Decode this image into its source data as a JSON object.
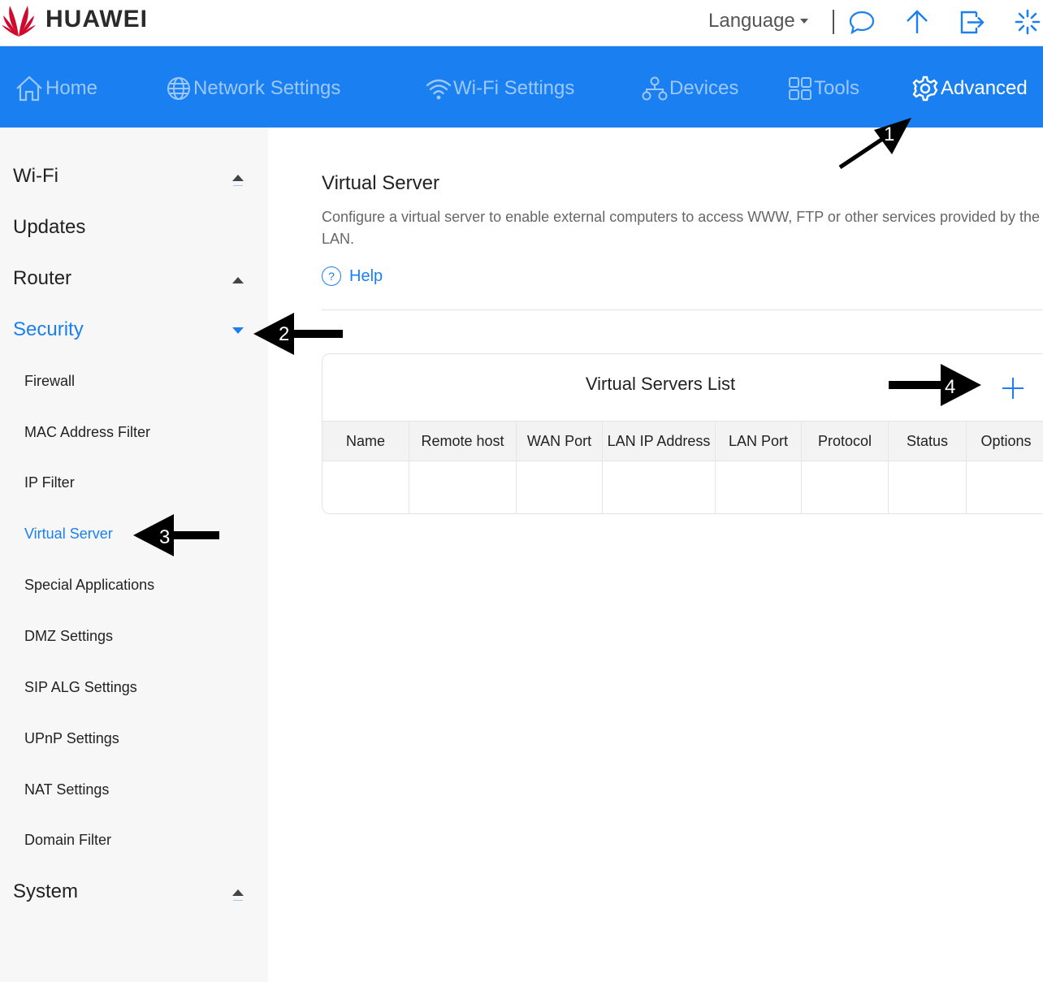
{
  "brand": {
    "name": "HUAWEI",
    "color": "#cf0a2c"
  },
  "header": {
    "language_label": "Language",
    "icons": [
      "chat-icon",
      "upload-icon",
      "logout-icon",
      "loading-icon"
    ]
  },
  "nav": {
    "items": [
      {
        "label": "Home",
        "icon": "home-icon"
      },
      {
        "label": "Network Settings",
        "icon": "globe-icon"
      },
      {
        "label": "Wi-Fi Settings",
        "icon": "wifi-icon"
      },
      {
        "label": "Devices",
        "icon": "devices-icon"
      },
      {
        "label": "Tools",
        "icon": "tools-icon"
      },
      {
        "label": "Advanced",
        "icon": "gear-icon",
        "active": true
      }
    ],
    "accent": "#1a7ff0"
  },
  "sidebar": {
    "sections": [
      {
        "label": "Wi-Fi",
        "expanded": false
      },
      {
        "label": "Updates"
      },
      {
        "label": "Router",
        "expanded": false
      },
      {
        "label": "Security",
        "expanded": true,
        "active": true
      },
      {
        "label": "System",
        "expanded": false
      }
    ],
    "security_items": [
      {
        "label": "Firewall"
      },
      {
        "label": "MAC Address Filter"
      },
      {
        "label": "IP Filter"
      },
      {
        "label": "Virtual Server",
        "active": true
      },
      {
        "label": "Special Applications"
      },
      {
        "label": "DMZ Settings"
      },
      {
        "label": "SIP ALG Settings"
      },
      {
        "label": "UPnP Settings"
      },
      {
        "label": "NAT Settings"
      },
      {
        "label": "Domain Filter"
      }
    ]
  },
  "main": {
    "title": "Virtual Server",
    "description_line1": "Configure a virtual server to enable external computers to access WWW, FTP or other services provided by the",
    "description_line2": "LAN.",
    "help_label": "Help",
    "help_icon_glyph": "?",
    "list": {
      "title": "Virtual Servers List",
      "columns": [
        "Name",
        "Remote host",
        "WAN Port",
        "LAN IP Address",
        "LAN Port",
        "Protocol",
        "Status",
        "Options"
      ],
      "rows": []
    }
  },
  "annotations": [
    "1",
    "2",
    "3",
    "4"
  ]
}
